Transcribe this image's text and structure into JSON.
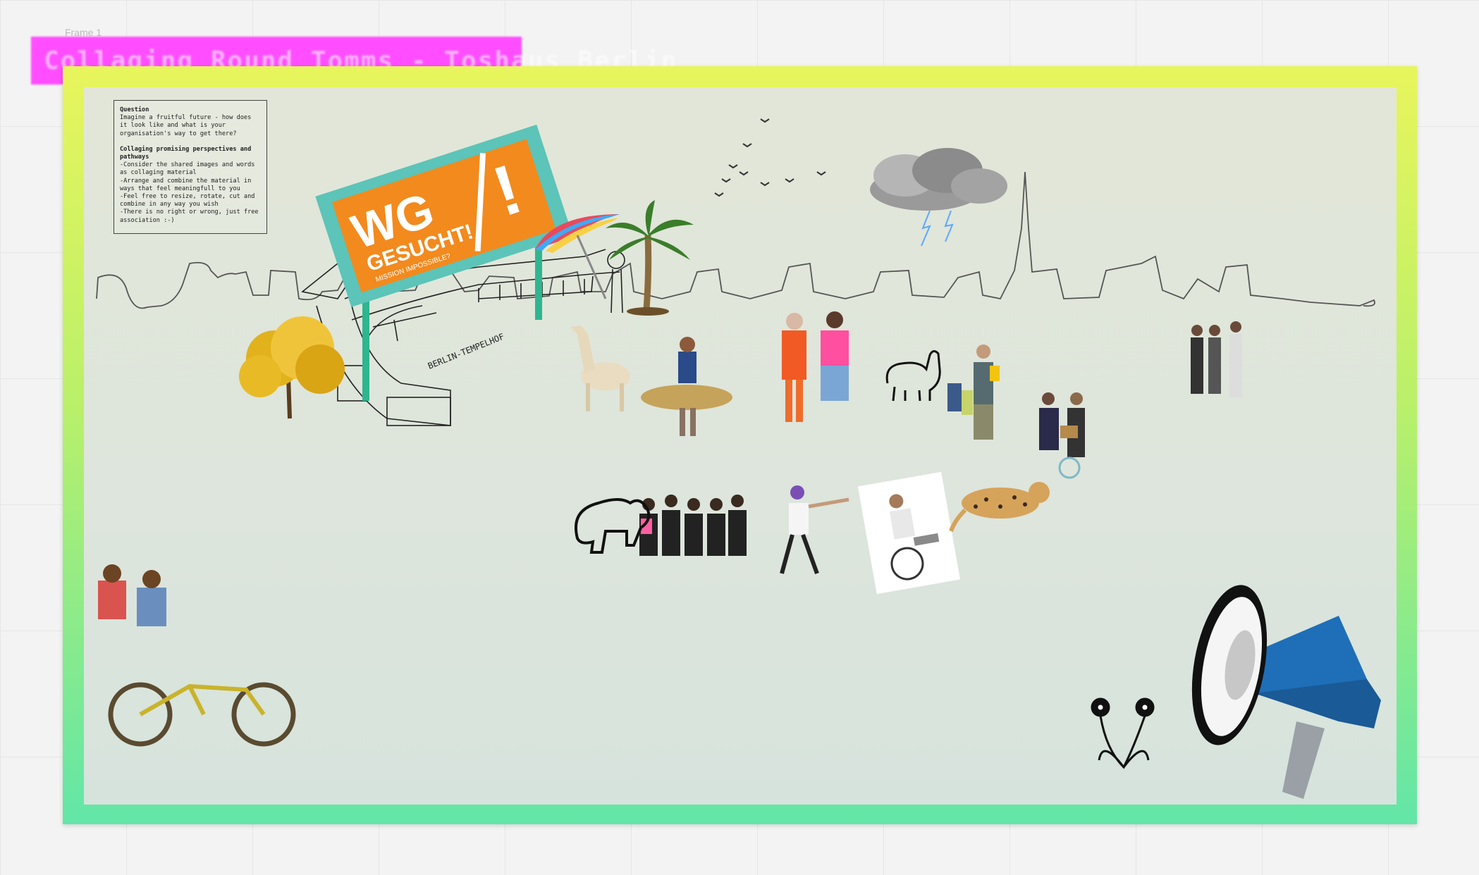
{
  "board": {
    "frame_label": "Frame 1",
    "title": "Collaging Round Tomms - Toshaus Berlin"
  },
  "note": {
    "question_heading": "Question",
    "question_lines": [
      "Imagine a fruitful future - how does",
      "it look like and what is your",
      "organisation's way to get there?"
    ],
    "task_heading_1": "Collaging promising perspectives and",
    "task_heading_2": "pathways",
    "task_lines": [
      "-Consider the shared images and words",
      "as collaging material",
      "-Arrange and combine the material in",
      "ways that feel meaningfull to you",
      "-Feel free to resize, rotate, cut and",
      "combine in any way you wish",
      "-There is no right or wrong, just free",
      "association :-)"
    ]
  },
  "billboard": {
    "main": "WG",
    "sub": "GESUCHT!",
    "tagline": "MISSION IMPOSSIBLE?",
    "mark": "!",
    "accent": "#f28a1e",
    "frame_color": "#5cc4b8"
  },
  "drawing": {
    "building_label": "BERLIN-TEMPELHOF"
  },
  "icons": [
    "skyline-outline-icon",
    "cloud-storm-icon",
    "birds-icon",
    "tree-icon",
    "palm-tree-icon",
    "umbrella-icon",
    "llama-outline-icon",
    "bear-outline-icon",
    "flower-outline-icon",
    "megaphone-icon",
    "jaguar-icon",
    "bicycle-icon",
    "wheelchair-icon"
  ]
}
